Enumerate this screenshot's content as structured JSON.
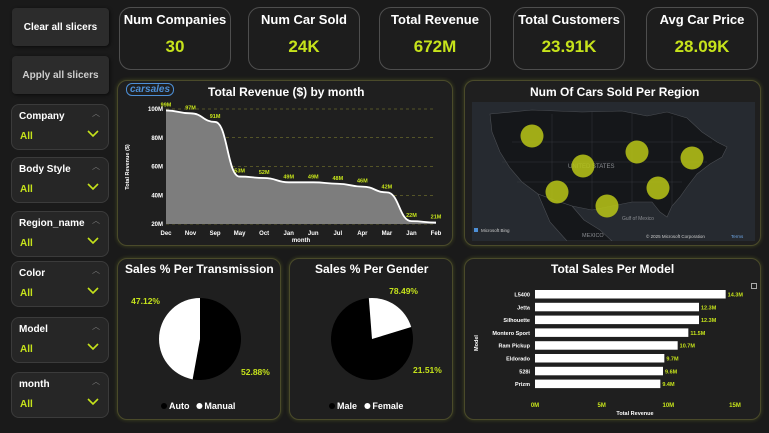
{
  "buttons": {
    "clear": "Clear all slicers",
    "apply": "Apply all slicers"
  },
  "slicers": [
    {
      "label": "Company",
      "value": "All"
    },
    {
      "label": "Body Style",
      "value": "All"
    },
    {
      "label": "Region_name",
      "value": "All"
    },
    {
      "label": "Color",
      "value": "All"
    },
    {
      "label": "Model",
      "value": "All"
    },
    {
      "label": "month",
      "value": "All"
    }
  ],
  "kpis": [
    {
      "title": "Num Companies",
      "value": "30"
    },
    {
      "title": "Num Car Sold",
      "value": "24K"
    },
    {
      "title": "Total Revenue",
      "value": "672M"
    },
    {
      "title": "Total Customers",
      "value": "23.91K"
    },
    {
      "title": "Avg Car Price",
      "value": "28.09K"
    }
  ],
  "logo_text": "carsales",
  "map": {
    "title": "Num Of Cars Sold Per Region",
    "labels": {
      "states": "UNITED STATES",
      "mexico": "MEXICO",
      "gulf": "Gulf of\nMexico"
    },
    "credits": {
      "left": "Microsoft Bing",
      "right": "© 2025 Microsoft Corporation",
      "terms": "Terms"
    },
    "bubble_color": "#b5c217"
  },
  "colors": {
    "accent": "#c6e31b",
    "card_border": "#4a4a2a"
  },
  "chart_data": [
    {
      "type": "area",
      "title": "Total Revenue ($) by month",
      "xlabel": "month",
      "ylabel": "Total Revenue ($)",
      "categories": [
        "Dec",
        "Nov",
        "Sep",
        "May",
        "Oct",
        "Jan",
        "Jun",
        "Jul",
        "Apr",
        "Mar",
        "Jan",
        "Feb"
      ],
      "values": [
        99,
        97,
        91,
        53,
        52,
        49,
        49,
        48,
        46,
        42,
        22,
        21
      ],
      "data_labels": [
        "99M",
        "97M",
        "91M",
        "53M",
        "52M",
        "49M",
        "49M",
        "48M",
        "46M",
        "42M",
        "22M",
        "21M"
      ],
      "yticks": [
        "20M",
        "40M",
        "60M",
        "80M",
        "100M"
      ],
      "ylim": [
        20,
        100
      ],
      "grid": true
    },
    {
      "type": "pie",
      "title": "Sales % Per Transmission",
      "categories": [
        "Auto",
        "Manual"
      ],
      "values": [
        52.88,
        47.12
      ],
      "data_labels": [
        "52.88%",
        "47.12%"
      ],
      "colors": [
        "#000000",
        "#ffffff"
      ],
      "legend": "bottom"
    },
    {
      "type": "pie",
      "title": "Sales % Per Gender",
      "categories": [
        "Male",
        "Female"
      ],
      "values": [
        78.49,
        21.51
      ],
      "data_labels": [
        "78.49%",
        "21.51%"
      ],
      "colors": [
        "#000000",
        "#ffffff"
      ],
      "legend": "bottom"
    },
    {
      "type": "bar",
      "orientation": "horizontal",
      "title": "Total Sales Per Model",
      "xlabel": "Total Revenue",
      "ylabel": "Model",
      "categories": [
        "L5400",
        "Jetta",
        "Silhouette",
        "Montero Sport",
        "Ram Pickup",
        "Eldorado",
        "528i",
        "Prizm"
      ],
      "values": [
        14.3,
        12.3,
        12.3,
        11.5,
        10.7,
        9.7,
        9.6,
        9.4
      ],
      "data_labels": [
        "14.3M",
        "12.3M",
        "12.3M",
        "11.5M",
        "10.7M",
        "9.7M",
        "9.6M",
        "9.4M"
      ],
      "xticks": [
        "0M",
        "5M",
        "10M",
        "15M"
      ],
      "xlim": [
        0,
        15
      ]
    }
  ]
}
